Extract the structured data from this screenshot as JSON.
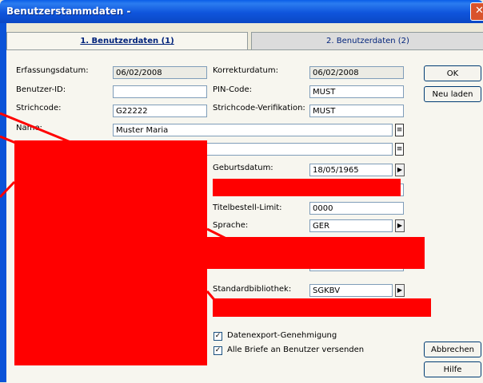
{
  "window": {
    "title": "Benutzerstammdaten -"
  },
  "tabs": [
    {
      "label": "1. Benutzerdaten (1)",
      "active": true
    },
    {
      "label": "2. Benutzerdaten (2)",
      "active": false
    }
  ],
  "form": {
    "erfassungsdatum": {
      "label": "Erfassungsdatum:",
      "value": "06/02/2008"
    },
    "korrekturdatum": {
      "label": "Korrekturdatum:",
      "value": "06/02/2008"
    },
    "benutzer_id": {
      "label": "Benutzer-ID:",
      "value": ""
    },
    "pin_code": {
      "label": "PIN-Code:",
      "value": "MUST"
    },
    "strichcode": {
      "label": "Strichcode:",
      "value": "G22222"
    },
    "strichcode_verifikation": {
      "label": "Strichcode-Verifikation:",
      "value": "MUST"
    },
    "name": {
      "label": "Name:",
      "value": "Muster Maria"
    },
    "name2": {
      "value": ""
    },
    "geburtsdatum": {
      "label": "Geburtsdatum:",
      "value": "18/05/1965"
    },
    "titelbestell_limit": {
      "label": "Titelbestell-Limit:",
      "value": "0000"
    },
    "sprache": {
      "label": "Sprache:",
      "value": "GER"
    },
    "standardbibliothek": {
      "label": "Standardbibliothek:",
      "value": "SGKBV"
    },
    "datenexport": {
      "label": "Datenexport-Genehmigung",
      "checked": true
    },
    "alle_briefe": {
      "label": "Alle Briefe an Benutzer versenden",
      "checked": true
    }
  },
  "buttons": {
    "ok": "OK",
    "neu_laden": "Neu laden",
    "abbrechen": "Abbrechen",
    "hilfe": "Hilfe"
  },
  "colors": {
    "redaction": "#ff0000",
    "titlebar": "#0a5ee8"
  }
}
